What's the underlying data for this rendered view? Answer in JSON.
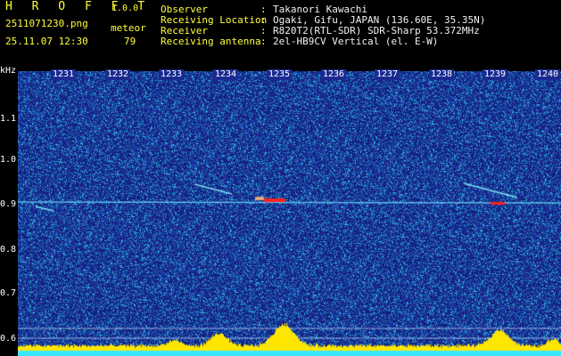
{
  "header": {
    "app_name": "H R O F F T",
    "version": "1.0.0",
    "filename": "2511071230.png",
    "meteor_label": "meteor",
    "datetime": "25.11.07 12:30",
    "meteor_count": "79"
  },
  "info": [
    {
      "label": "Observer",
      "value": "Takanori Kawachi"
    },
    {
      "label": "Receiving Location",
      "value": "Ogaki, Gifu, JAPAN (136.60E, 35.35N)"
    },
    {
      "label": "Receiver",
      "value": "R820T2(RTL-SDR) SDR-Sharp 53.372MHz"
    },
    {
      "label": "Receiving antenna",
      "value": "2el-HB9CV Vertical (el. E-W)"
    }
  ],
  "axis": {
    "unit": "kHz",
    "minutes": [
      "1231",
      "1232",
      "1233",
      "1234",
      "1235",
      "1236",
      "1237",
      "1238",
      "1239",
      "1240"
    ],
    "freqs": [
      "1.1",
      "1.0",
      "0.9",
      "0.8",
      "0.7",
      "0.6"
    ]
  },
  "colors": {
    "background": "#1c2f9a",
    "text_yellow": "#ffff3a",
    "signal_cyan": "#5ee0ff",
    "signal_hot": "#ff2020",
    "level_yellow": "#ffe600"
  }
}
